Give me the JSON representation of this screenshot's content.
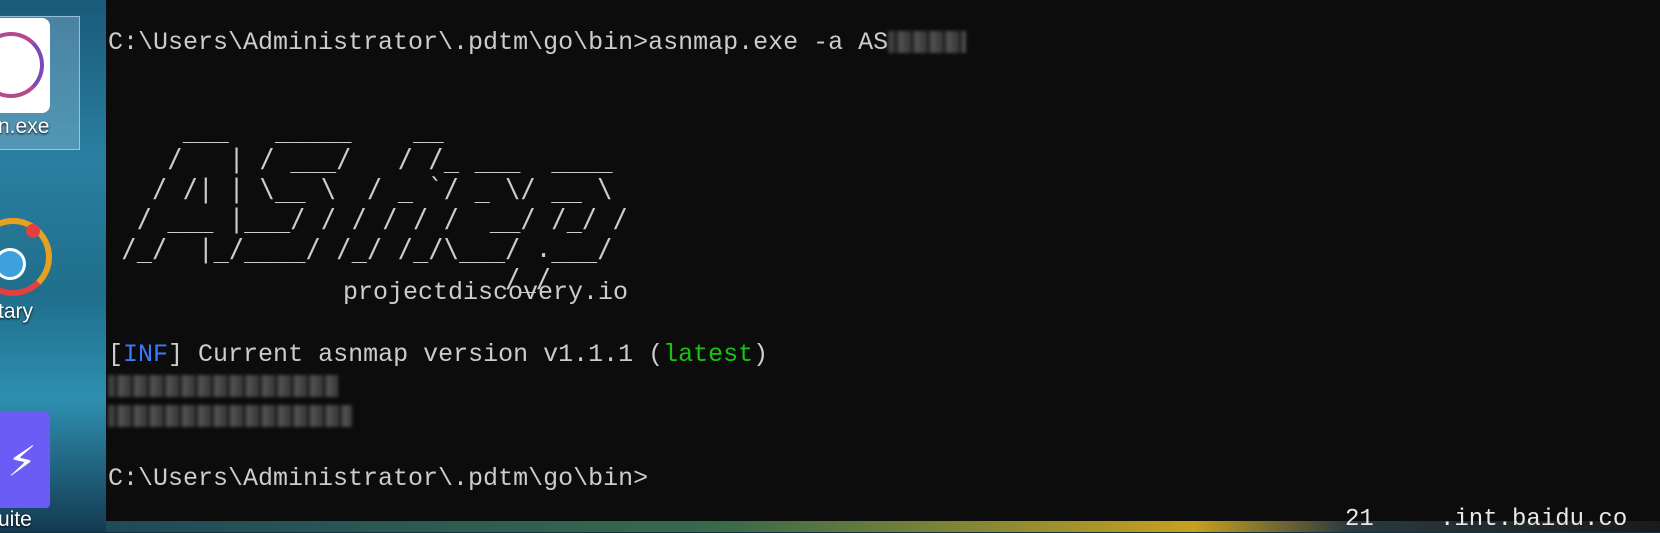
{
  "desktop": {
    "icons": [
      {
        "label": "n.exe",
        "icon": "circle-app-icon"
      },
      {
        "label": "tary",
        "icon": "radar-app-icon"
      },
      {
        "label": "uite",
        "icon": "bolt-app-icon"
      }
    ]
  },
  "console": {
    "prompt1": "C:\\Users\\Administrator\\.pdtm\\go\\bin>",
    "command": "asnmap.exe -a AS",
    "banner": "     ___   _____    __\n    /   | / ___/   / /_ ___  ____\n   / /| | \\__ \\  / _ `/ _ \\/ __ \\\n  / ___ |___/ / / / / /  __/ /_/ /\n /_/  |_/____/ /_/ /_/\\___/ .___/\n                          /_/",
    "site": "projectdiscovery.io",
    "inf_open": "[",
    "inf_tag": "INF",
    "inf_close": "]",
    "inf_msg": " Current asnmap version v1.1.1 (",
    "inf_latest": "latest",
    "inf_end": ")",
    "prompt2": "C:\\Users\\Administrator\\.pdtm\\go\\bin>"
  },
  "taskbar": {
    "num": "21",
    "domain": ".int.baidu.co"
  },
  "colors": {
    "console_bg": "#0c0c0c",
    "console_fg": "#cccccc",
    "info_blue": "#3b78ff",
    "latest_green": "#16c60c"
  }
}
